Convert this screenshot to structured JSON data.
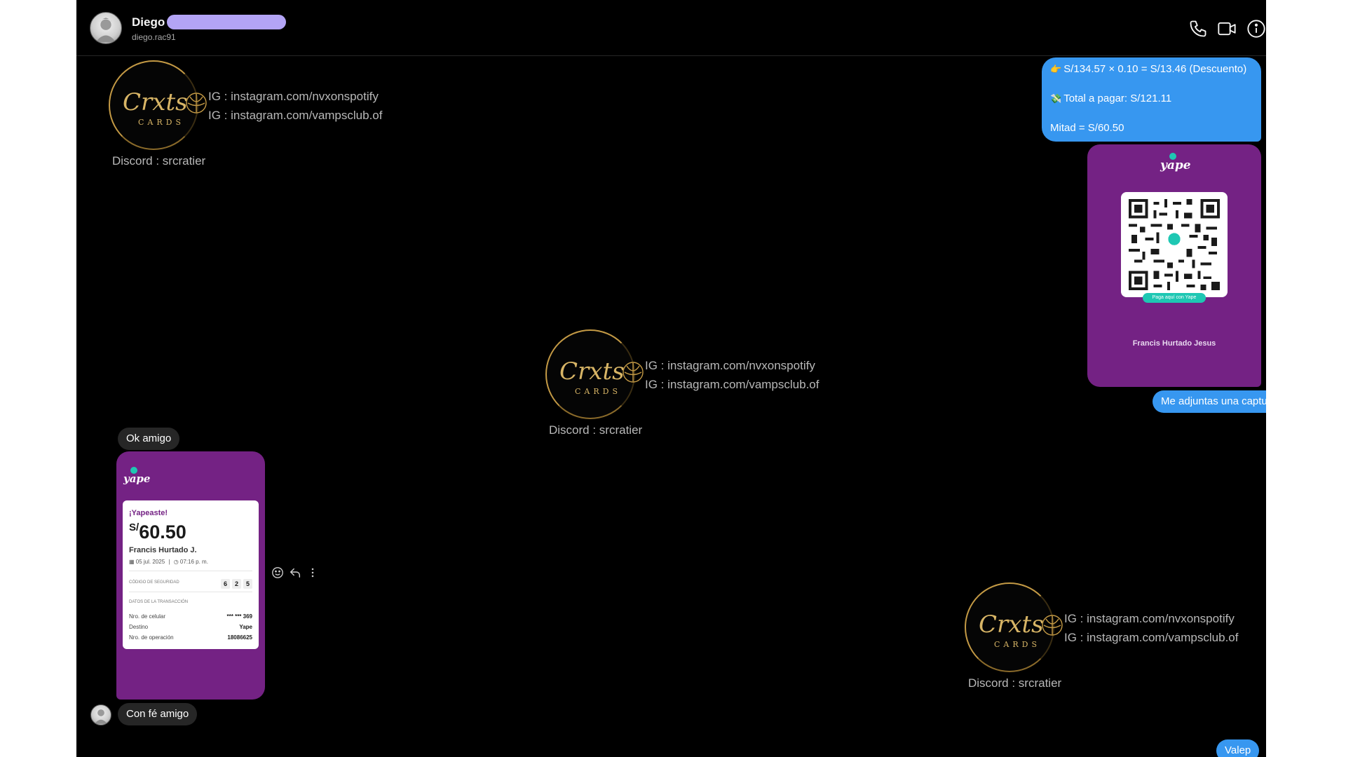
{
  "header": {
    "name": "Diego",
    "username": "diego.rac91",
    "icons": [
      "phone-icon",
      "video-call-icon",
      "info-icon"
    ]
  },
  "watermark": {
    "logo_text": "Crxts",
    "logo_sub": "CARDS",
    "ig1": "IG : instagram.com/nvxonspotify",
    "ig2": "IG : instagram.com/vampsclub.of",
    "discord": "Discord : srcratier"
  },
  "messages": {
    "calc": {
      "line1": "S/134.57 × 0.10 = S/13.46 (Descuento)",
      "line2": "Total a pagar: S/121.11",
      "line3": "Mitad = S/60.50",
      "emoji1": "👉",
      "emoji2": "💸"
    },
    "qr": {
      "brand": "yape",
      "pill": "Paga aquí con Yape",
      "name": "Francis Hurtado Jesus"
    },
    "captura": "Me adjuntas una captura por favor",
    "ok": "Ok amigo",
    "receipt": {
      "brand": "yape",
      "title": "¡Yapeaste!",
      "currency": "S/",
      "amount": "60.50",
      "payee": "Francis Hurtado J.",
      "date": "05 jul. 2025",
      "time": "07:16 p. m.",
      "security_label": "CÓDIGO DE SEGURIDAD",
      "security_code": [
        "6",
        "2",
        "5"
      ],
      "details_label": "DATOS DE LA TRANSACCIÓN",
      "rows": [
        {
          "label": "Nro. de celular",
          "value": "*** *** 369"
        },
        {
          "label": "Destino",
          "value": "Yape"
        },
        {
          "label": "Nro. de operación",
          "value": "18086625"
        }
      ]
    },
    "confe": "Con fé amigo",
    "valep": "Valep"
  },
  "colors": {
    "background": "#000000",
    "outgoing": "#3797f0",
    "incoming": "#262626",
    "yape_purple": "#742284",
    "yape_teal": "#1ec7b3",
    "redaction": "#b3a4f5"
  }
}
